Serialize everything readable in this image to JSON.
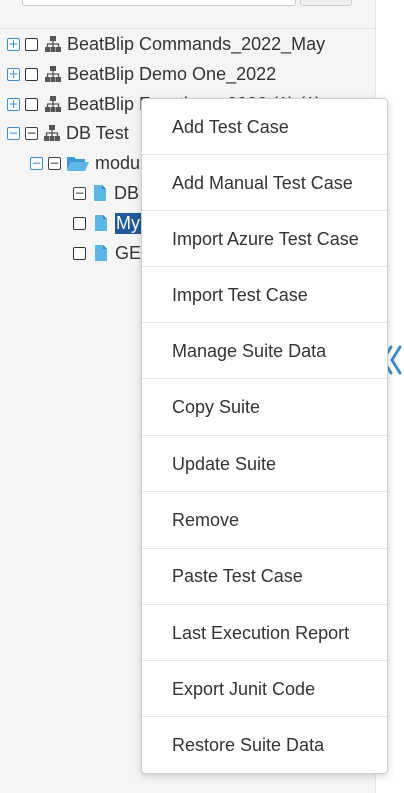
{
  "tree": {
    "items": [
      {
        "label": "BeatBlip Commands_2022_May"
      },
      {
        "label": "BeatBlip Demo One_2022"
      },
      {
        "label": "BeatBlip Functions_2022 (1) (1)"
      },
      {
        "label": "DB Test"
      },
      {
        "label": "modu"
      },
      {
        "label": "DB"
      },
      {
        "label": "My"
      },
      {
        "label": "GE"
      }
    ]
  },
  "context_menu": {
    "items": [
      {
        "label": "Add Test Case"
      },
      {
        "label": "Add Manual Test Case"
      },
      {
        "label": "Import Azure Test Case"
      },
      {
        "label": "Import Test Case"
      },
      {
        "label": "Manage Suite Data"
      },
      {
        "label": "Copy Suite"
      },
      {
        "label": "Update Suite"
      },
      {
        "label": "Remove"
      },
      {
        "label": "Paste Test Case"
      },
      {
        "label": "Last Execution Report"
      },
      {
        "label": "Export Junit Code"
      },
      {
        "label": "Restore Suite Data"
      }
    ]
  },
  "icons": {
    "expand": "plus-box-icon",
    "collapse": "minus-box-icon",
    "suite": "sitemap-icon",
    "folder": "folder-open-icon",
    "file": "file-icon",
    "panel_toggle": "double-chevron-left-icon"
  },
  "colors": {
    "selection": "#215a9c",
    "accent": "#3a8fd1",
    "file_icon": "#5bb8e6"
  }
}
